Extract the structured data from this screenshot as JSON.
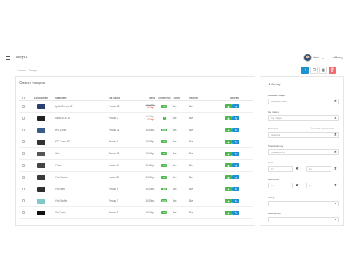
{
  "header": {
    "title": "Товары",
    "user_name": "demo",
    "logout_label": "Выход"
  },
  "breadcrumb": [
    "Главная",
    "Товары"
  ],
  "toolbar": {
    "add_icon": "plus-icon",
    "copy_icon": "copy-icon",
    "filter_icon": "filter-icon",
    "delete_icon": "trash-icon"
  },
  "list": {
    "title": "Список товаров",
    "columns": {
      "image": "Изображение",
      "name": "Название",
      "model": "Код товара",
      "price": "Цена",
      "quantity": "Количество",
      "status": "Статус",
      "main": "Наличие",
      "actions": "Действие"
    },
    "rows": [
      {
        "name": "Apple Cinema 30\"",
        "model": "Product 15",
        "price_old": "100.00р.",
        "price_new": "90.00р.",
        "qty": "990",
        "status": "Вкл",
        "main": "Вкл",
        "thumb_color": "#2b3f6e"
      },
      {
        "name": "Canon EOS 5D",
        "model": "Product 3",
        "price_old": "100.00р.",
        "price_new": "80.00р.",
        "qty": "7",
        "status": "Вкл",
        "main": "Вкл",
        "thumb_color": "#222222"
      },
      {
        "name": "HP LP3065",
        "model": "Product 21",
        "price_old": "",
        "price_new": "",
        "price": "100.00р.",
        "qty": "1000",
        "status": "Вкл",
        "main": "Вкл",
        "thumb_color": "#3a5b86"
      },
      {
        "name": "HTC Touch HD",
        "model": "Product 1",
        "price_old": "",
        "price_new": "",
        "price": "100.00р.",
        "qty": "939",
        "status": "Вкл",
        "main": "Вкл",
        "thumb_color": "#333333"
      },
      {
        "name": "iMac",
        "model": "Product 14",
        "price_old": "",
        "price_new": "",
        "price": "100.00р.",
        "qty": "977",
        "status": "Вкл",
        "main": "Вкл",
        "thumb_color": "#555555"
      },
      {
        "name": "iPhone",
        "model": "product 11",
        "price_old": "",
        "price_new": "",
        "price": "101.00р.",
        "qty": "970",
        "status": "Вкл",
        "main": "Вкл",
        "thumb_color": "#444444"
      },
      {
        "name": "iPod Classic",
        "model": "product 20",
        "price_old": "",
        "price_new": "",
        "price": "100.00р.",
        "qty": "995",
        "status": "Вкл",
        "main": "Вкл",
        "thumb_color": "#3a3a3a"
      },
      {
        "name": "iPod Nano",
        "model": "Product 9",
        "price_old": "",
        "price_new": "",
        "price": "100.00р.",
        "qty": "994",
        "status": "Вкл",
        "main": "Вкл",
        "thumb_color": "#2f2f2f"
      },
      {
        "name": "iPod Shuffle",
        "model": "Product 7",
        "price_old": "",
        "price_new": "",
        "price": "100.00р.",
        "qty": "1000",
        "status": "Вкл",
        "main": "Вкл",
        "thumb_color": "#7fc7c9"
      },
      {
        "name": "iPod Touch",
        "model": "Product 5",
        "price_old": "",
        "price_new": "",
        "price": "100.00р.",
        "qty": "995",
        "status": "Вкл",
        "main": "Вкл",
        "thumb_color": "#111111"
      }
    ]
  },
  "filter": {
    "title": "Фильтр",
    "name_label": "Название товара",
    "name_placeholder": "Название товара",
    "model_label": "Код товара",
    "model_placeholder": "Код товара",
    "category_label": "Категория",
    "category_extra": "включая подкатегории",
    "category_placeholder": "Категория",
    "manufacturer_label": "Производитель",
    "manufacturer_placeholder": "Производитель",
    "price_label": "Цена",
    "price_from": "От",
    "price_to": "До",
    "qty_label": "Количество",
    "qty_from": "От",
    "qty_to": "До",
    "status_label": "Статус",
    "main_label": "Наличие/сорт"
  },
  "colors": {
    "primary": "#1e91cf",
    "success": "#4cb64c",
    "danger": "#f56b6b",
    "sale": "#e5482d"
  }
}
